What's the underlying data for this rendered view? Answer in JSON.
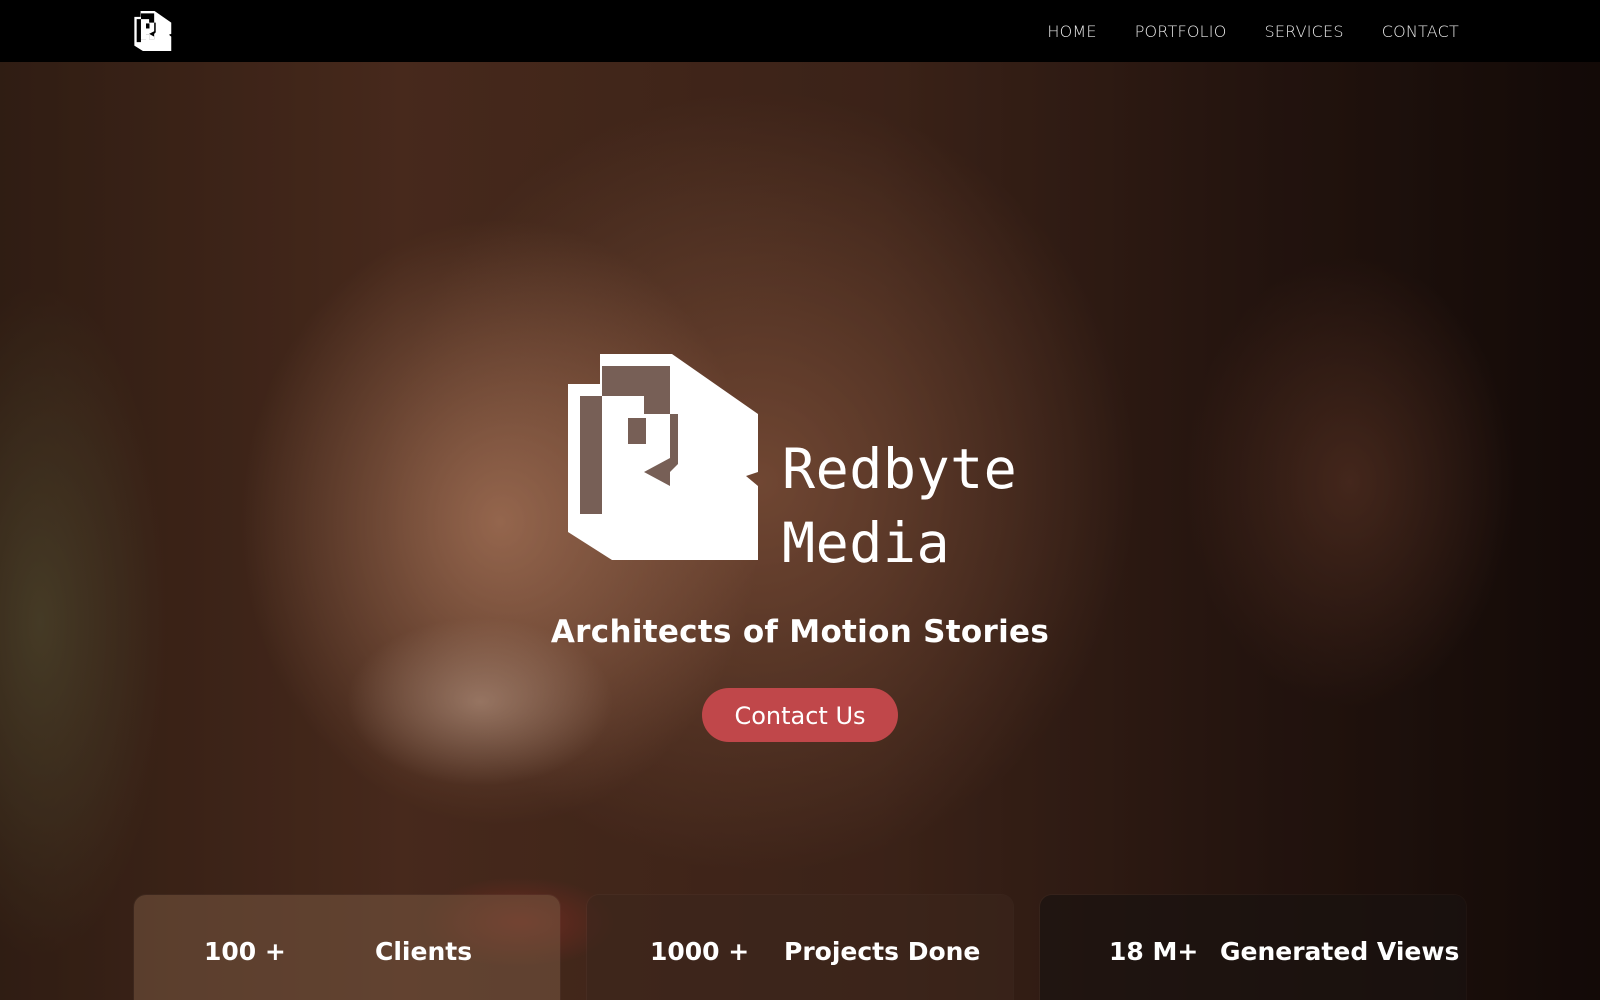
{
  "nav": {
    "logo_icon": "redbyte-r-logo",
    "links": [
      "HOME",
      "PORTFOLIO",
      "SERVICES",
      "CONTACT"
    ]
  },
  "hero": {
    "brand_line1": "Redbyte",
    "brand_line2": "Media",
    "tagline": "Architects of Motion Stories",
    "cta_label": "Contact Us"
  },
  "stats": [
    {
      "value": "100 +",
      "label": "Clients"
    },
    {
      "value": "1000 +",
      "label": "Projects Done"
    },
    {
      "value": "18 M+",
      "label": "Generated Views"
    }
  ],
  "colors": {
    "accent": "#c0474a",
    "nav_bg": "#000000",
    "text": "#ffffff"
  }
}
